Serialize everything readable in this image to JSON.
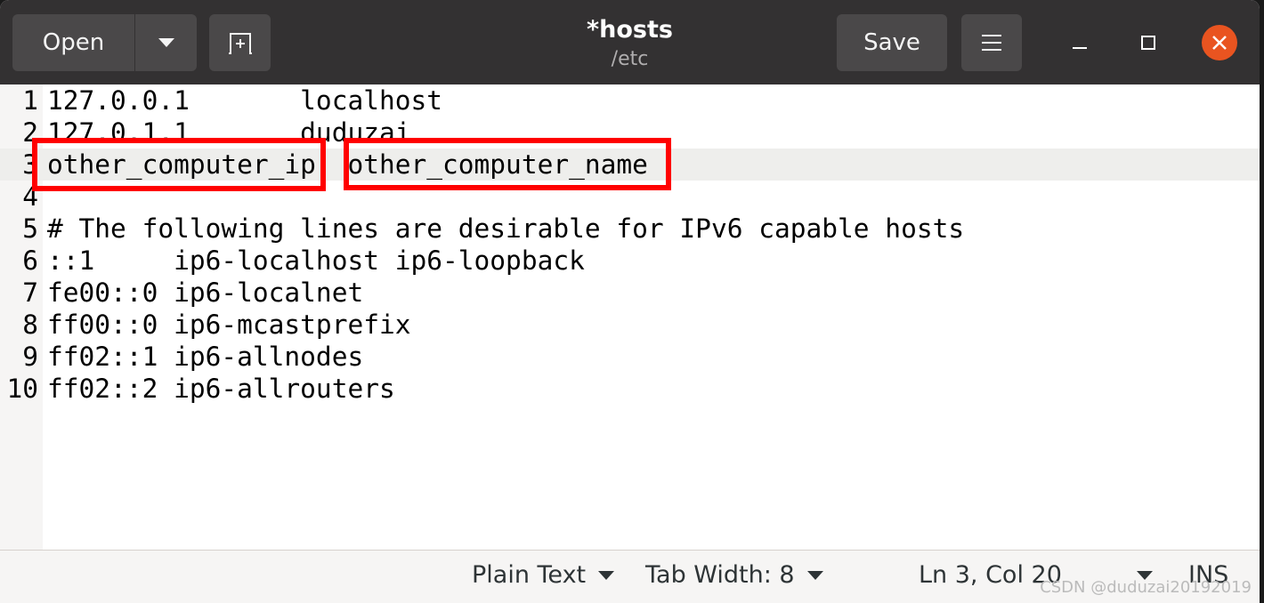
{
  "header": {
    "open_label": "Open",
    "title": "*hosts",
    "subtitle": "/etc",
    "save_label": "Save",
    "icons": [
      "chevron-down-icon",
      "new-tab-icon",
      "hamburger-menu-icon",
      "minimize-icon",
      "maximize-icon",
      "close-icon"
    ],
    "close_color": "#e95420"
  },
  "editor": {
    "current_line": 3,
    "lines": [
      {
        "num": "1",
        "text": "127.0.0.1       localhost"
      },
      {
        "num": "2",
        "text": "127.0.1.1       duduzai"
      },
      {
        "num": "3",
        "text": "other_computer_ip  other_computer_name"
      },
      {
        "num": "4",
        "text": ""
      },
      {
        "num": "5",
        "text": "# The following lines are desirable for IPv6 capable hosts"
      },
      {
        "num": "6",
        "text": "::1     ip6-localhost ip6-loopback"
      },
      {
        "num": "7",
        "text": "fe00::0 ip6-localnet"
      },
      {
        "num": "8",
        "text": "ff00::0 ip6-mcastprefix"
      },
      {
        "num": "9",
        "text": "ff02::1 ip6-allnodes"
      },
      {
        "num": "10",
        "text": "ff02::2 ip6-allrouters"
      }
    ]
  },
  "status": {
    "language": "Plain Text",
    "tab_width": "Tab Width: 8",
    "position": "Ln 3, Col 20",
    "mode": "INS"
  },
  "annotation_color": "#ff0000",
  "watermark": "CSDN @duduzai20192019"
}
